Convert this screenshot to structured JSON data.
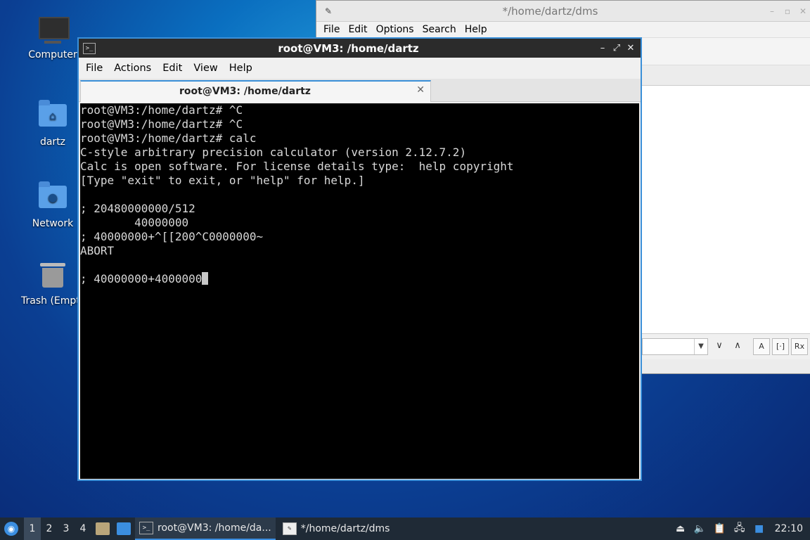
{
  "desktop": {
    "icons": [
      {
        "label": "Computer"
      },
      {
        "label": "dartz"
      },
      {
        "label": "Network"
      },
      {
        "label": "Trash (Empty)"
      }
    ]
  },
  "editor_window": {
    "title": "*/home/dartz/dms",
    "menu": [
      "File",
      "Edit",
      "Options",
      "Search",
      "Help"
    ],
    "controls": [
      "–",
      "▫",
      "✕"
    ],
    "find_buttons": [
      "∨",
      "∧",
      "A",
      "[·]",
      "Rx"
    ]
  },
  "terminal": {
    "title": "root@VM3: /home/dartz",
    "menu": [
      "File",
      "Actions",
      "Edit",
      "View",
      "Help"
    ],
    "tab_title": "root@VM3: /home/dartz",
    "lines": [
      "root@VM3:/home/dartz# ^C",
      "root@VM3:/home/dartz# ^C",
      "root@VM3:/home/dartz# calc",
      "C-style arbitrary precision calculator (version 2.12.7.2)",
      "Calc is open software. For license details type:  help copyright",
      "[Type \"exit\" to exit, or \"help\" for help.]",
      "",
      "; 20480000000/512",
      "        40000000",
      "; 40000000+^[[200^C0000000~",
      "ABORT",
      "",
      "; 40000000+4000000"
    ]
  },
  "taskbar": {
    "workspaces": [
      "1",
      "2",
      "3",
      "4"
    ],
    "tasks": [
      {
        "label": "root@VM3: /home/da...",
        "active": true
      },
      {
        "label": "*/home/dartz/dms",
        "active": false
      }
    ],
    "clock": "22:10"
  }
}
